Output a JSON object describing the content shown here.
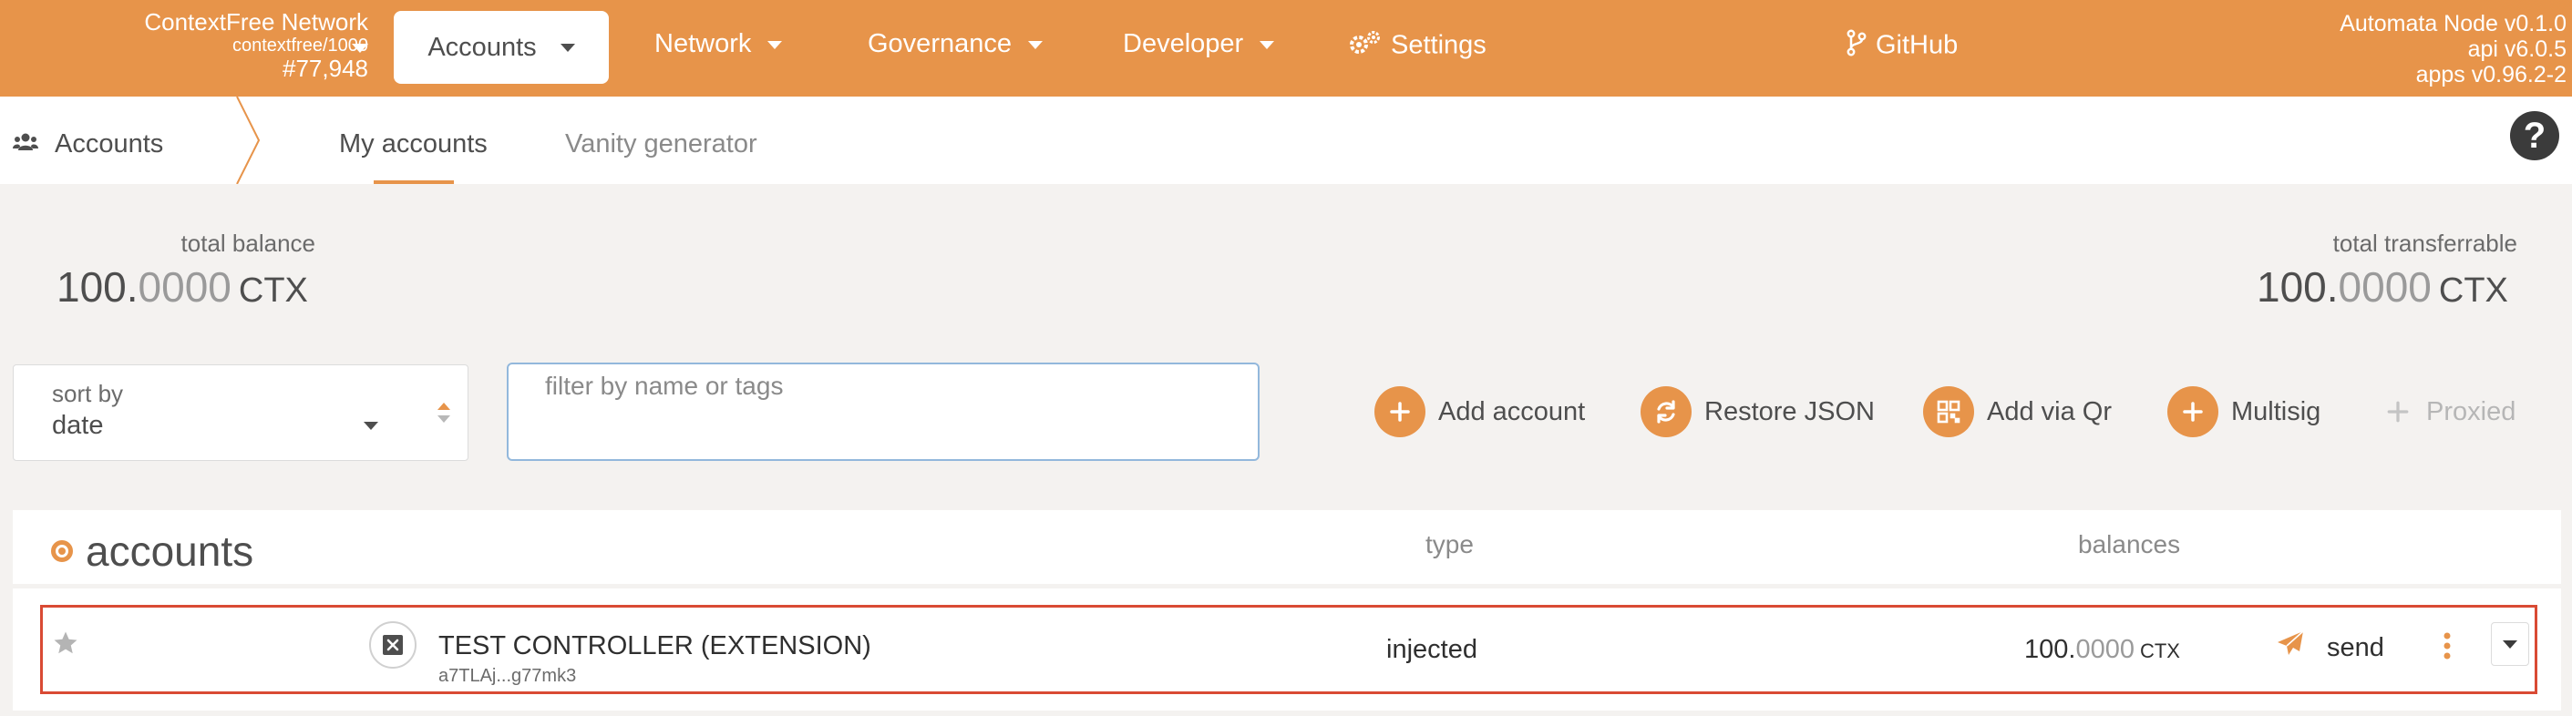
{
  "header": {
    "chain_name": "ContextFree Network",
    "chain_sub": "contextfree/1000",
    "block_number": "#77,948",
    "nav": {
      "accounts": "Accounts",
      "network": "Network",
      "governance": "Governance",
      "developer": "Developer",
      "settings": "Settings",
      "github": "GitHub"
    },
    "version": {
      "node": "Automata Node v0.1.0",
      "api": "api v6.0.5",
      "apps": "apps v0.96.2-2"
    }
  },
  "subnav": {
    "section": "Accounts",
    "tabs": [
      {
        "label": "My accounts",
        "active": true
      },
      {
        "label": "Vanity generator",
        "active": false
      }
    ],
    "help": "?"
  },
  "summary": {
    "total_balance_label": "total balance",
    "total_balance_int": "100.",
    "total_balance_dec": "0000",
    "total_balance_unit": "CTX",
    "total_transferrable_label": "total transferrable",
    "total_transferrable_int": "100.",
    "total_transferrable_dec": "0000",
    "total_transferrable_unit": "CTX"
  },
  "controls": {
    "sort_label": "sort by",
    "sort_value": "date",
    "filter_placeholder": "filter by name or tags",
    "filter_value": "",
    "actions": {
      "add_account": "Add account",
      "restore_json": "Restore JSON",
      "add_via_qr": "Add via Qr",
      "multisig": "Multisig",
      "proxied": "Proxied"
    }
  },
  "table": {
    "title": "accounts",
    "col_type": "type",
    "col_balances": "balances",
    "rows": [
      {
        "name": "TEST CONTROLLER (EXTENSION)",
        "address": "a7TLAj...g77mk3",
        "type": "injected",
        "balance_int": "100.",
        "balance_dec": "0000",
        "balance_unit": "CTX",
        "send": "send"
      }
    ]
  },
  "colors": {
    "accent": "#e7944a",
    "highlight_border": "#d94a34"
  }
}
